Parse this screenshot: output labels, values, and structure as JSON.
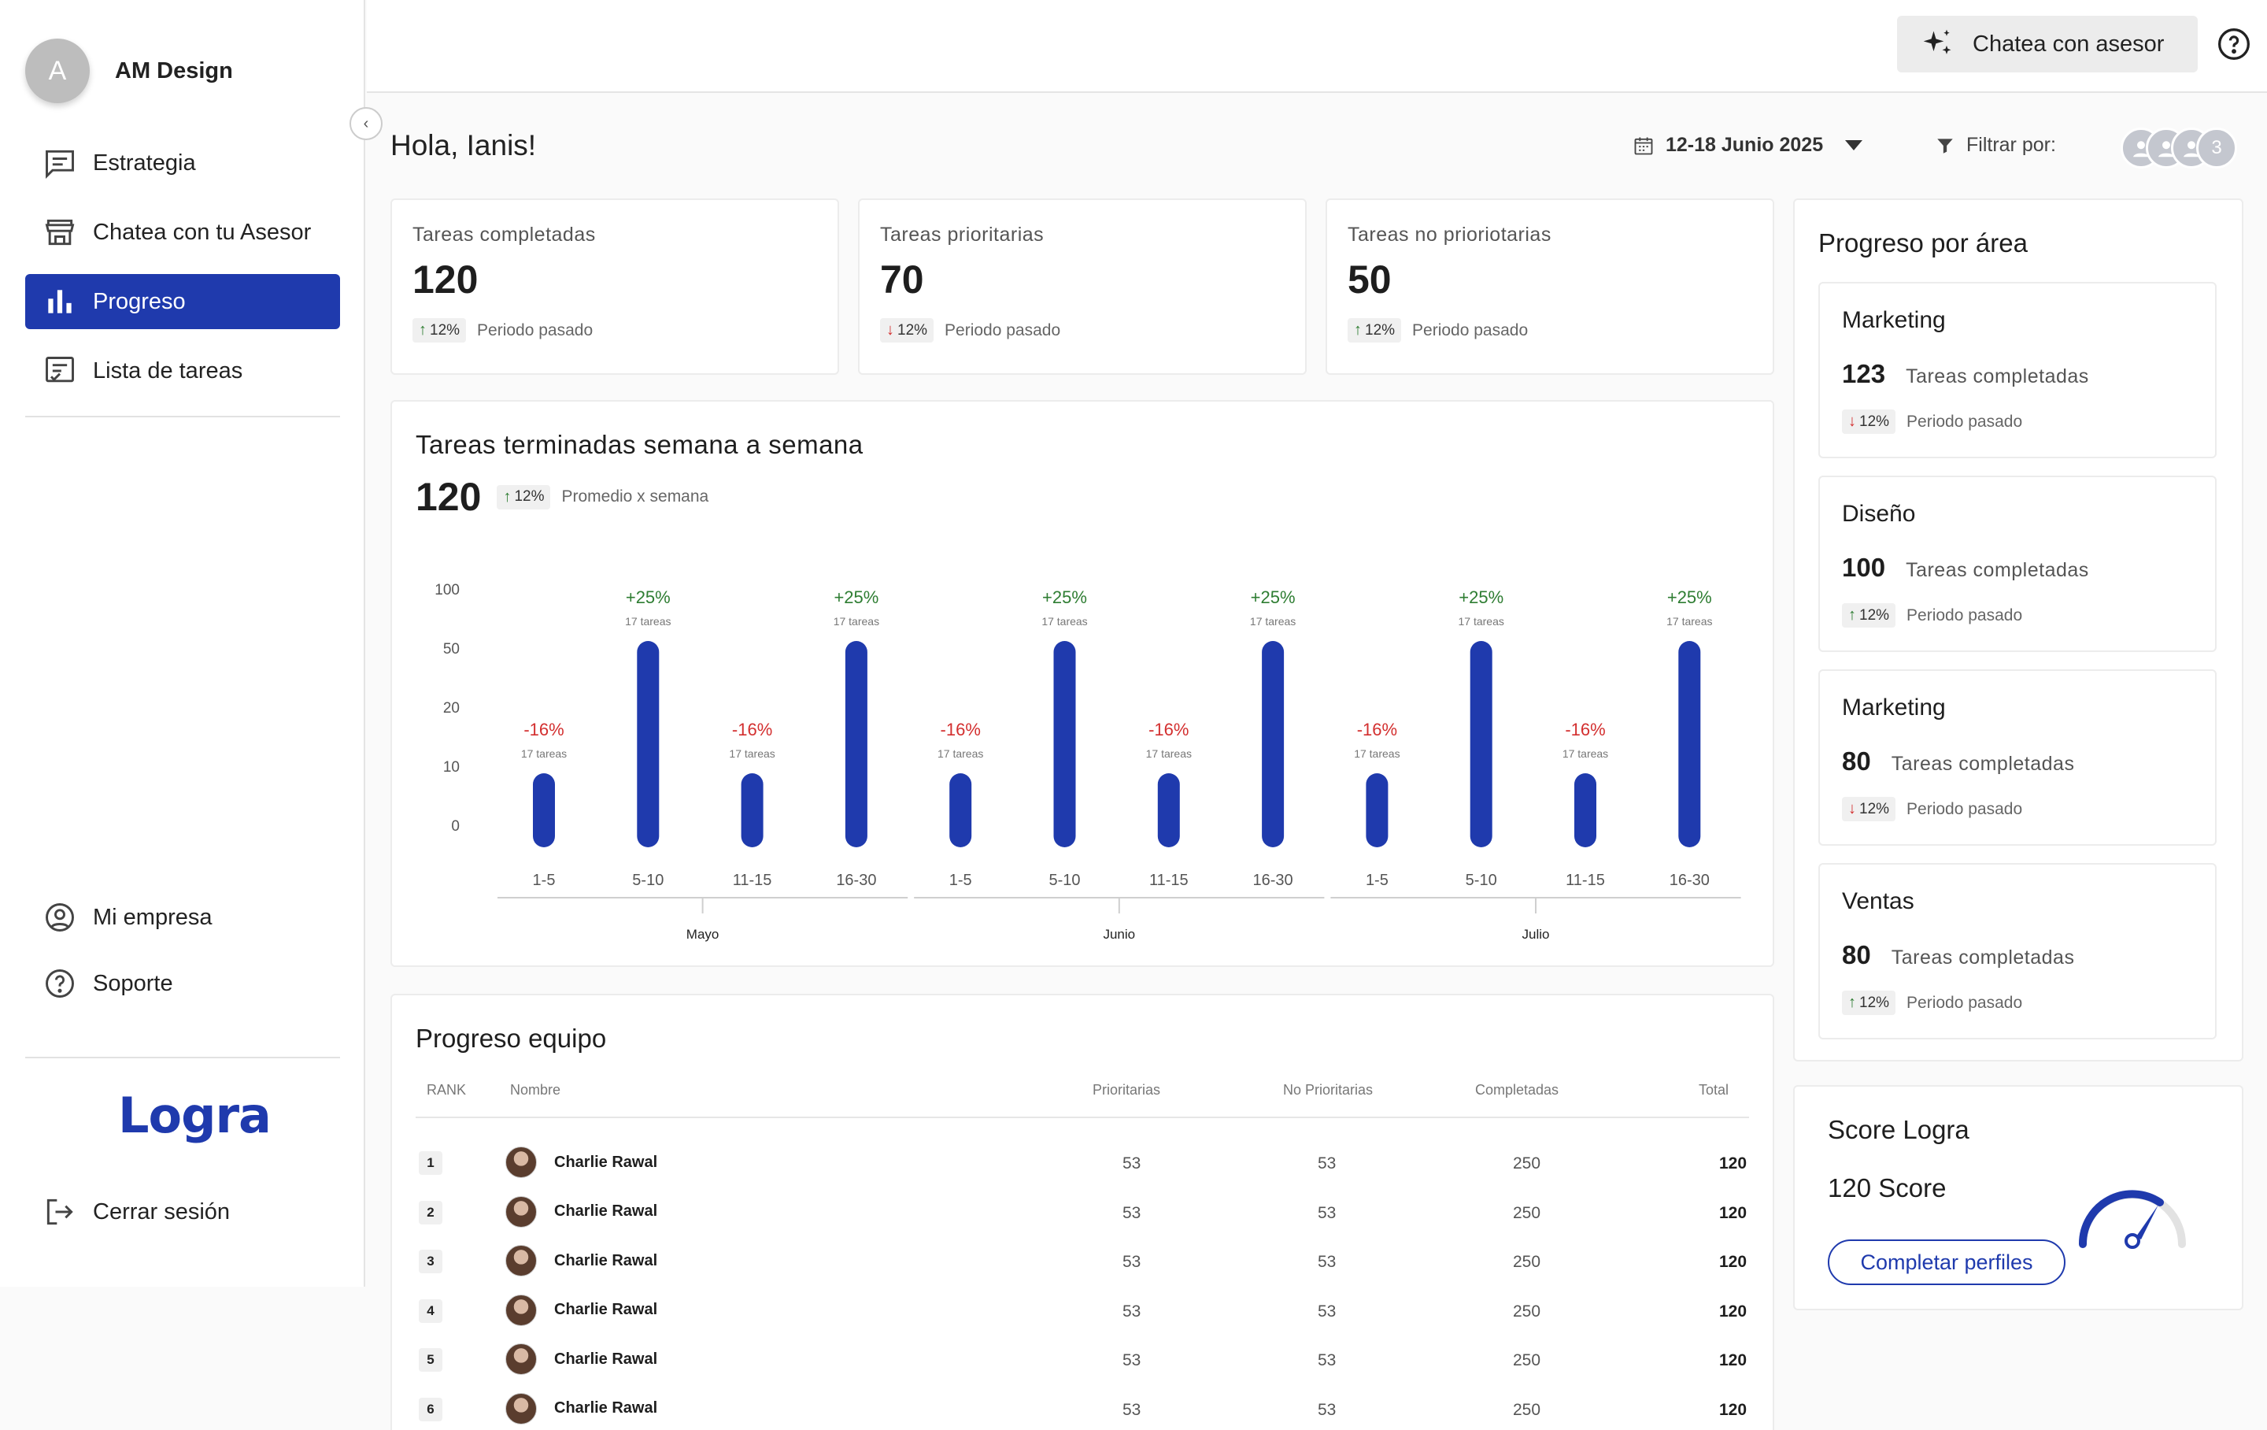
{
  "sidebar": {
    "profile": {
      "initial": "A",
      "name": "AM Design"
    },
    "items": [
      {
        "label": "Estrategia",
        "icon": "chat-lines-icon"
      },
      {
        "label": "Chatea con tu Asesor",
        "icon": "store-icon"
      },
      {
        "label": "Progreso",
        "icon": "bar-chart-icon",
        "active": true
      },
      {
        "label": "Lista de tareas",
        "icon": "task-list-icon"
      }
    ],
    "bottom_items": [
      {
        "label": "Mi empresa",
        "icon": "user-circle-icon"
      },
      {
        "label": "Soporte",
        "icon": "help-circle-icon"
      }
    ],
    "logo": "Logra",
    "logout": "Cerrar sesión"
  },
  "topbar": {
    "chat_label": "Chatea con asesor"
  },
  "header": {
    "greeting": "Hola, Ianis!",
    "date_range": "12-18 Junio 2025",
    "filter_label": "Filtrar por:",
    "avatar_count": "3"
  },
  "stats": [
    {
      "title": "Tareas completadas",
      "value": "120",
      "delta": "12%",
      "dir": "up",
      "note": "Periodo pasado"
    },
    {
      "title": "Tareas prioritarias",
      "value": "70",
      "delta": "12%",
      "dir": "down",
      "note": "Periodo pasado"
    },
    {
      "title": "Tareas no prioriotarias",
      "value": "50",
      "delta": "12%",
      "dir": "up",
      "note": "Periodo pasado"
    }
  ],
  "weekly": {
    "title": "Tareas terminadas semana a semana",
    "avg": "120",
    "avg_delta": "12%",
    "avg_label": "Promedio x semana"
  },
  "chart_data": {
    "type": "bar",
    "y_ticks": [
      "100",
      "50",
      "20",
      "10",
      "0"
    ],
    "categories": [
      "1-5",
      "5-10",
      "11-15",
      "16-30",
      "1-5",
      "5-10",
      "11-15",
      "16-30",
      "1-5",
      "5-10",
      "11-15",
      "16-30"
    ],
    "values": [
      10,
      50,
      10,
      50,
      10,
      50,
      10,
      50,
      10,
      50,
      10,
      50
    ],
    "change_labels": [
      "-16%",
      "+25%",
      "-16%",
      "+25%",
      "-16%",
      "+25%",
      "-16%",
      "+25%",
      "-16%",
      "+25%",
      "-16%",
      "+25%"
    ],
    "sub_labels": [
      "17 tareas",
      "17 tareas",
      "17 tareas",
      "17 tareas",
      "17 tareas",
      "17 tareas",
      "17 tareas",
      "17 tareas",
      "17 tareas",
      "17 tareas",
      "17 tareas",
      "17 tareas"
    ],
    "groups": [
      "Mayo",
      "Junio",
      "Julio"
    ],
    "bar_color": "#1f3aad",
    "up_color": "#2e7d32",
    "down_color": "#d32f2f"
  },
  "areas": {
    "title": "Progreso por área",
    "items": [
      {
        "name": "Marketing",
        "value": "123",
        "label": "Tareas completadas",
        "delta": "12%",
        "dir": "down",
        "note": "Periodo pasado"
      },
      {
        "name": "Diseño",
        "value": "100",
        "label": "Tareas completadas",
        "delta": "12%",
        "dir": "up",
        "note": "Periodo pasado"
      },
      {
        "name": "Marketing",
        "value": "80",
        "label": "Tareas completadas",
        "delta": "12%",
        "dir": "down",
        "note": "Periodo pasado"
      },
      {
        "name": "Ventas",
        "value": "80",
        "label": "Tareas completadas",
        "delta": "12%",
        "dir": "up",
        "note": "Periodo pasado"
      }
    ]
  },
  "score": {
    "title": "Score Logra",
    "value": "120 Score",
    "button": "Completar perfiles"
  },
  "team": {
    "title": "Progreso equipo",
    "columns": [
      "RANK",
      "Nombre",
      "Prioritarias",
      "No Prioritarias",
      "Completadas",
      "Total"
    ],
    "rows": [
      {
        "rank": "1",
        "name": "Charlie Rawal",
        "prioritarias": "53",
        "no_prioritarias": "53",
        "completadas": "250",
        "total": "120"
      },
      {
        "rank": "2",
        "name": "Charlie Rawal",
        "prioritarias": "53",
        "no_prioritarias": "53",
        "completadas": "250",
        "total": "120"
      },
      {
        "rank": "3",
        "name": "Charlie Rawal",
        "prioritarias": "53",
        "no_prioritarias": "53",
        "completadas": "250",
        "total": "120"
      },
      {
        "rank": "4",
        "name": "Charlie Rawal",
        "prioritarias": "53",
        "no_prioritarias": "53",
        "completadas": "250",
        "total": "120"
      },
      {
        "rank": "5",
        "name": "Charlie Rawal",
        "prioritarias": "53",
        "no_prioritarias": "53",
        "completadas": "250",
        "total": "120"
      },
      {
        "rank": "6",
        "name": "Charlie Rawal",
        "prioritarias": "53",
        "no_prioritarias": "53",
        "completadas": "250",
        "total": "120"
      }
    ]
  }
}
